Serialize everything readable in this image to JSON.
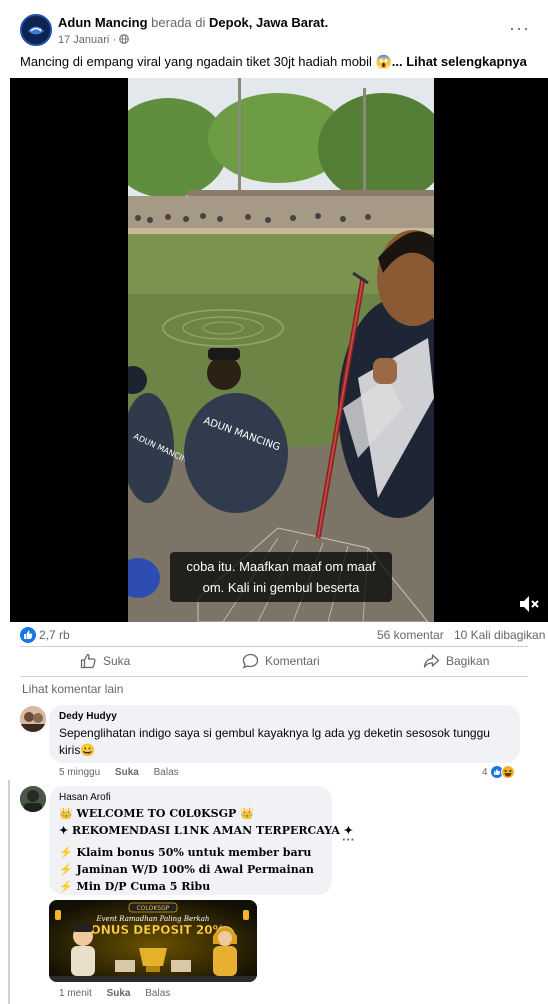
{
  "post": {
    "author": "Adun Mancing",
    "at_text": "berada di",
    "location": "Depok, Jawa Barat.",
    "date": "17 Januari",
    "date_sep": "·",
    "privacy_icon": "globe-icon",
    "caption": "Mancing di empang viral yang ngadain tiket 30jt hadiah mobil 😱",
    "see_more": "... Lihat selengkapnya"
  },
  "video": {
    "subtitle_line1": "coba itu. Maafkan maaf om maaf",
    "subtitle_line2": "om. Kali ini gembul beserta",
    "shirt_text_1": "ADUN MANCING",
    "shirt_text_2": "ADUN MANCING",
    "mute_icon": "volume-muted-icon"
  },
  "stats": {
    "likes": "2,7 rb",
    "comments": "56 komentar",
    "shares": "10 Kali dibagikan"
  },
  "actions": {
    "like": "Suka",
    "comment": "Komentari",
    "share": "Bagikan"
  },
  "more_comments": "Lihat komentar lain",
  "comments": [
    {
      "name": "Dedy Hudyy",
      "text": "Sepenglihatan indigo saya si gembul kayaknya lg ada yg deketin sesosok tunggu kiris😀",
      "time": "5 minggu",
      "like": "Suka",
      "reply": "Balas",
      "reactions_count": "4",
      "reaction_icons": [
        "like-icon",
        "haha-icon"
      ]
    },
    {
      "name": "Hasan Arofi",
      "lines": [
        "👑 WELCOME TO C0L0KSGP 👑",
        "✦ REKOMENDASI L1NK AMAN TERPERCAYA ✦",
        "⚡ Klaim bonus 50% untuk member baru",
        "⚡ Jaminan W/D 100% di Awal Permainan",
        "⚡ Min D/P Cuma 5 Ribu"
      ],
      "image_title_small": "Event Ramadhan Paling Berkah",
      "image_title_big": "BONUS DEPOSIT 20%",
      "image_logo": "COLOKSGP",
      "time": "1 menit",
      "like": "Suka",
      "reply": "Balas",
      "more": "···"
    }
  ],
  "colors": {
    "accent": "#1b74e4",
    "muted_text": "#65676b",
    "bubble_bg": "#f0f2f5"
  }
}
